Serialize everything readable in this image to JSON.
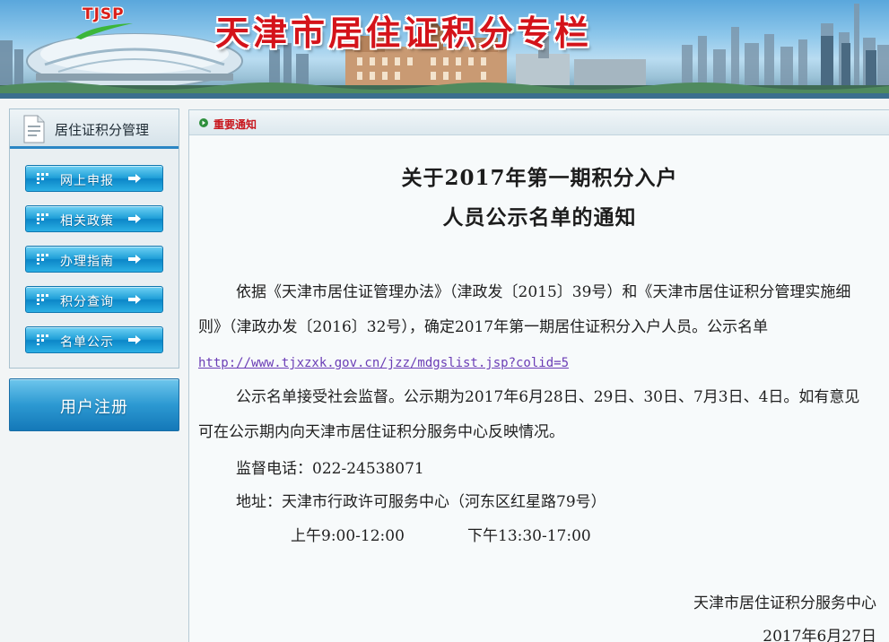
{
  "banner": {
    "logo": "TJSP",
    "title": "天津市居住证积分专栏"
  },
  "sidebar": {
    "header": "居住证积分管理",
    "items": [
      {
        "label": "网上申报"
      },
      {
        "label": "相关政策"
      },
      {
        "label": "办理指南"
      },
      {
        "label": "积分查询"
      },
      {
        "label": "名单公示"
      }
    ],
    "register": "用户注册"
  },
  "main": {
    "section": "重要通知",
    "title_line1": "关于2017年第一期积分入户",
    "title_line2": "人员公示名单的通知",
    "p1_text": "依据《天津市居住证管理办法》（津政发〔2015〕39号）和《天津市居住证积分管理实施细则》（津政办发〔2016〕32号），确定2017年第一期居住证积分入户人员。公示名单",
    "p1_link": "http://www.tjxzxk.gov.cn/jzz/mdgslist.jsp?colid=5",
    "p2_text": "公示名单接受社会监督。公示期为2017年6月28日、29日、30日、7月3日、4日。如有意见可在公示期内向天津市居住证积分服务中心反映情况。",
    "phone": "监督电话：022-24538071",
    "address": "地址：天津市行政许可服务中心（河东区红星路79号）",
    "hours_am": "上午9:00-12:00",
    "hours_pm": "下午13:30-17:00",
    "signature": "天津市居住证积分服务中心",
    "date": "2017年6月27日"
  }
}
